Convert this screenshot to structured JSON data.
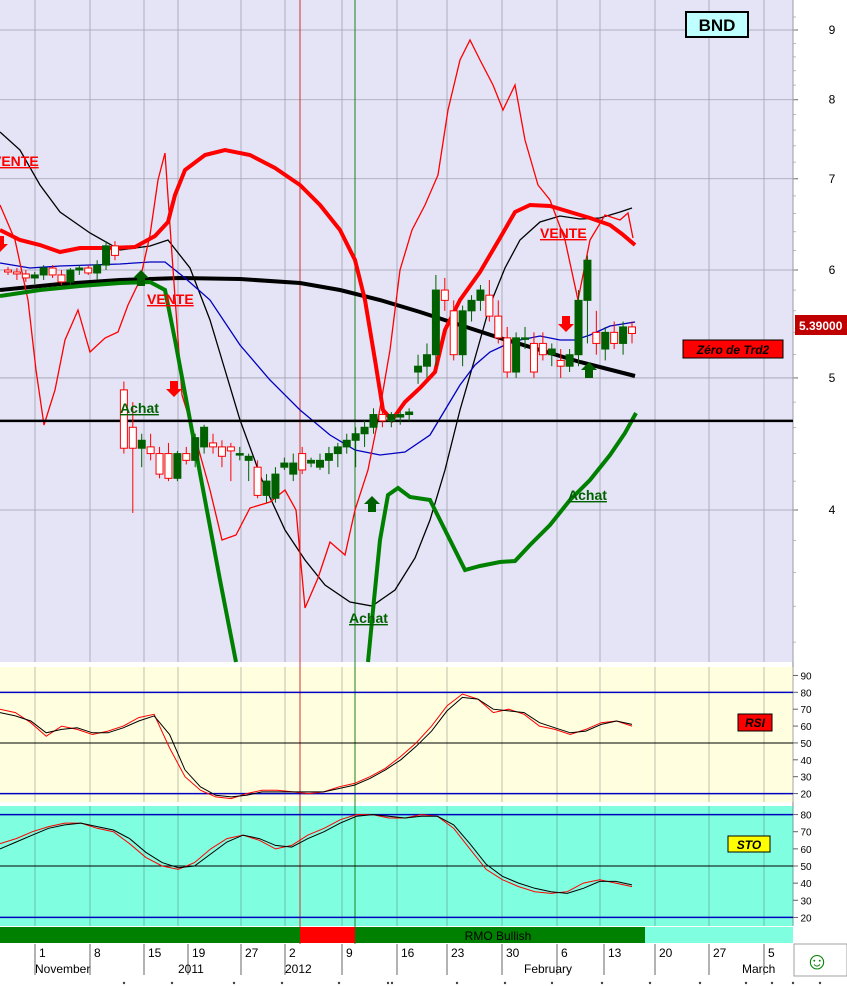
{
  "ticker": "BND",
  "last_price_label": "5.39000",
  "zero_label": "Zéro de Trd2",
  "rsi_label": "RSI",
  "sto_label": "STO",
  "rmo_label": "RMO Bullish",
  "smiley": "☺",
  "colors": {
    "price_bg": "#e4e4f6",
    "rsi_bg": "#ffffe0",
    "sto_bg": "#80ffe0",
    "bull": "#006000",
    "bear": "#ff0000",
    "sto_badge_bg": "#ffff00"
  },
  "chart_data": [
    {
      "type": "candlestick",
      "panel": "price",
      "y_ticks": [
        4,
        5,
        6,
        7,
        8,
        9
      ],
      "ylim": [
        3.0,
        9.4
      ],
      "x_labels": [
        "1",
        "8",
        "15",
        "19",
        "27",
        "2",
        "9",
        "16",
        "23",
        "30",
        "6",
        "13",
        "20",
        "27",
        "5"
      ],
      "x_labels_lower": [
        "November",
        "2011",
        "2012",
        "February",
        "March"
      ],
      "candles": [
        [
          6.0,
          6.03,
          5.95,
          5.98
        ],
        [
          5.98,
          6.02,
          5.9,
          5.96
        ],
        [
          5.96,
          6.0,
          5.88,
          5.92
        ],
        [
          5.92,
          5.98,
          5.86,
          5.95
        ],
        [
          5.95,
          6.05,
          5.9,
          6.02
        ],
        [
          6.02,
          6.05,
          5.92,
          5.95
        ],
        [
          5.95,
          6.0,
          5.85,
          5.88
        ],
        [
          5.88,
          6.02,
          5.85,
          6.0
        ],
        [
          6.0,
          6.05,
          5.95,
          6.02
        ],
        [
          6.02,
          6.05,
          5.95,
          5.97
        ],
        [
          5.97,
          6.1,
          5.9,
          6.05
        ],
        [
          6.05,
          6.3,
          6.0,
          6.25
        ],
        [
          6.25,
          6.3,
          6.1,
          6.15
        ],
        [
          4.9,
          4.97,
          4.4,
          4.44
        ],
        [
          4.6,
          4.8,
          3.98,
          4.44
        ],
        [
          4.44,
          4.55,
          4.3,
          4.5
        ],
        [
          4.45,
          4.55,
          4.35,
          4.4
        ],
        [
          4.4,
          4.45,
          4.22,
          4.25
        ],
        [
          4.4,
          4.48,
          4.2,
          4.22
        ],
        [
          4.22,
          4.42,
          4.2,
          4.4
        ],
        [
          4.4,
          4.45,
          4.32,
          4.35
        ],
        [
          4.35,
          4.55,
          4.3,
          4.52
        ],
        [
          4.45,
          4.62,
          4.4,
          4.6
        ],
        [
          4.48,
          4.55,
          4.4,
          4.45
        ],
        [
          4.45,
          4.5,
          4.3,
          4.38
        ],
        [
          4.45,
          4.48,
          4.2,
          4.42
        ],
        [
          4.4,
          4.45,
          4.35,
          4.4
        ],
        [
          4.35,
          4.4,
          4.2,
          4.38
        ],
        [
          4.3,
          4.35,
          4.08,
          4.1
        ],
        [
          4.1,
          4.25,
          4.05,
          4.2
        ],
        [
          4.08,
          4.3,
          4.05,
          4.25
        ],
        [
          4.3,
          4.37,
          4.28,
          4.33
        ],
        [
          4.25,
          4.4,
          4.2,
          4.33
        ],
        [
          4.4,
          4.45,
          4.25,
          4.28
        ],
        [
          4.33,
          4.37,
          4.3,
          4.35
        ],
        [
          4.3,
          4.4,
          4.28,
          4.35
        ],
        [
          4.35,
          4.45,
          4.25,
          4.4
        ],
        [
          4.4,
          4.48,
          4.3,
          4.45
        ],
        [
          4.45,
          4.55,
          4.4,
          4.5
        ],
        [
          4.5,
          4.6,
          4.3,
          4.55
        ],
        [
          4.55,
          4.65,
          4.45,
          4.6
        ],
        [
          4.6,
          4.75,
          4.55,
          4.7
        ],
        [
          4.7,
          4.75,
          4.6,
          4.65
        ],
        [
          4.65,
          4.72,
          4.6,
          4.7
        ],
        [
          4.68,
          4.73,
          4.62,
          4.7
        ],
        [
          4.7,
          4.75,
          4.65,
          4.72
        ],
        [
          5.05,
          5.2,
          4.95,
          5.1
        ],
        [
          5.1,
          5.3,
          5.0,
          5.2
        ],
        [
          5.2,
          5.95,
          5.1,
          5.8
        ],
        [
          5.8,
          5.92,
          5.6,
          5.7
        ],
        [
          5.6,
          5.7,
          5.15,
          5.2
        ],
        [
          5.2,
          5.65,
          5.1,
          5.6
        ],
        [
          5.6,
          5.75,
          5.5,
          5.7
        ],
        [
          5.7,
          5.85,
          5.6,
          5.8
        ],
        [
          5.75,
          5.9,
          5.5,
          5.55
        ],
        [
          5.55,
          5.7,
          5.3,
          5.35
        ],
        [
          5.35,
          5.45,
          5.0,
          5.05
        ],
        [
          5.05,
          5.4,
          5.0,
          5.35
        ],
        [
          5.35,
          5.45,
          5.25,
          5.35
        ],
        [
          5.3,
          5.4,
          5.0,
          5.05
        ],
        [
          5.3,
          5.4,
          5.15,
          5.2
        ],
        [
          5.2,
          5.3,
          5.1,
          5.25
        ],
        [
          5.15,
          5.25,
          5.0,
          5.1
        ],
        [
          5.1,
          5.25,
          5.05,
          5.2
        ],
        [
          5.2,
          5.8,
          5.1,
          5.7
        ],
        [
          5.7,
          6.15,
          5.3,
          6.1
        ],
        [
          5.4,
          5.6,
          5.2,
          5.3
        ],
        [
          5.25,
          5.45,
          5.15,
          5.4
        ],
        [
          5.4,
          5.5,
          5.25,
          5.3
        ],
        [
          5.3,
          5.5,
          5.2,
          5.45
        ],
        [
          5.45,
          5.5,
          5.3,
          5.39
        ]
      ],
      "horizontal_line": 4.65,
      "signals": [
        {
          "type": "VENTE",
          "text": "VENTE"
        },
        {
          "type": "VENTE",
          "text": "VENTE"
        },
        {
          "type": "VENTE",
          "text": "VENTE"
        },
        {
          "type": "Achat",
          "text": "Achat"
        },
        {
          "type": "Achat",
          "text": "Achat"
        },
        {
          "type": "Achat",
          "text": "Achat"
        }
      ]
    },
    {
      "type": "line",
      "panel": "RSI",
      "y_ticks": [
        20,
        30,
        40,
        50,
        60,
        70,
        80,
        90
      ],
      "ylim": [
        15,
        95
      ],
      "bands": [
        20,
        80
      ],
      "mid": 50,
      "series": [
        {
          "values": [
            70,
            68,
            62,
            54,
            60,
            58,
            55,
            57,
            60,
            65,
            67,
            47,
            30,
            22,
            18,
            17,
            20,
            22,
            22,
            21,
            20,
            21,
            24,
            26,
            30,
            35,
            42,
            50,
            60,
            72,
            79,
            76,
            68,
            70,
            67,
            60,
            58,
            55,
            58,
            62,
            63,
            60
          ]
        },
        {
          "values": [
            68,
            66,
            63,
            56,
            58,
            59,
            56,
            56,
            59,
            63,
            66,
            55,
            34,
            24,
            19,
            18,
            19,
            21,
            21,
            21,
            21,
            21,
            23,
            25,
            29,
            34,
            40,
            48,
            57,
            69,
            77,
            76,
            70,
            69,
            68,
            62,
            59,
            56,
            57,
            61,
            63,
            61
          ]
        }
      ]
    },
    {
      "type": "line",
      "panel": "STO",
      "y_ticks": [
        20,
        30,
        40,
        50,
        60,
        70,
        80
      ],
      "ylim": [
        15,
        85
      ],
      "bands": [
        20,
        80
      ],
      "mid": 50,
      "series": [
        {
          "values": [
            63,
            66,
            70,
            73,
            75,
            75,
            72,
            70,
            63,
            55,
            50,
            48,
            52,
            60,
            66,
            68,
            65,
            60,
            62,
            68,
            72,
            77,
            80,
            80,
            78,
            78,
            80,
            79,
            72,
            60,
            48,
            42,
            38,
            35,
            34,
            35,
            40,
            42,
            40,
            38
          ]
        },
        {
          "values": [
            60,
            64,
            68,
            72,
            74,
            75,
            73,
            71,
            66,
            58,
            52,
            49,
            50,
            57,
            64,
            68,
            66,
            62,
            61,
            66,
            70,
            75,
            79,
            80,
            79,
            78,
            79,
            79,
            74,
            63,
            51,
            44,
            40,
            37,
            35,
            34,
            37,
            41,
            41,
            39
          ]
        }
      ]
    }
  ]
}
